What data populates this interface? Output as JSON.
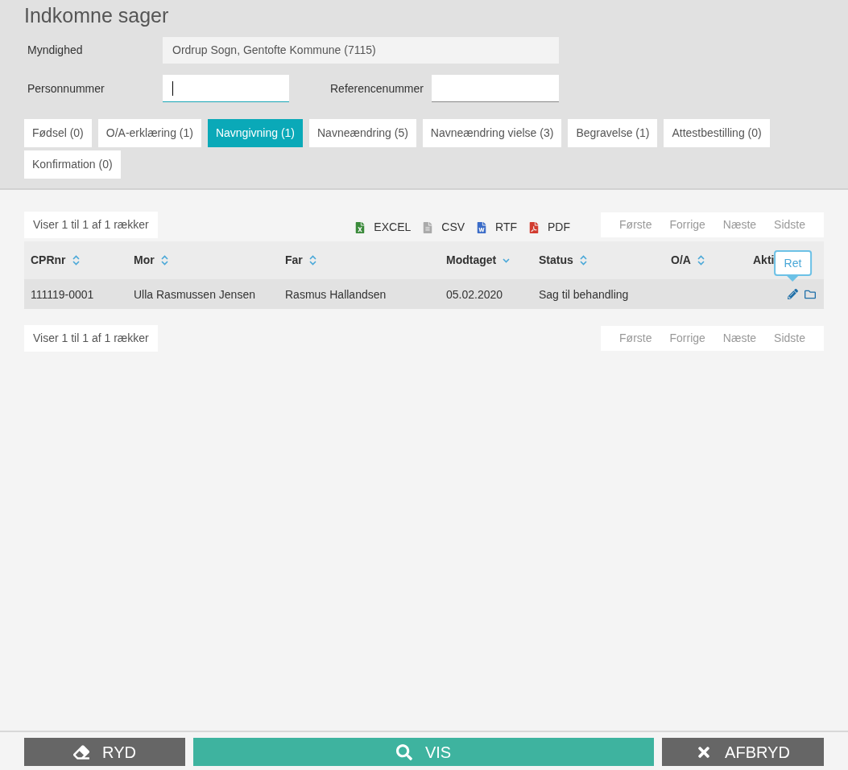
{
  "title": "Indkomne sager",
  "fields": [
    {
      "label": "Myndighed",
      "value": "Ordrup Sogn, Gentofte Kommune (7115)",
      "kind": "readonly"
    }
  ],
  "person_field": {
    "label": "Personnummer",
    "focused": true
  },
  "reference_field": {
    "label": "Referencenummer",
    "focused": false
  },
  "tabs": [
    {
      "label": "Fødsel (0)",
      "selected": false
    },
    {
      "label": "O/A-erklæring (1)",
      "selected": false
    },
    {
      "label": "Navngivning (1)",
      "selected": true
    },
    {
      "label": "Navneændring (5)",
      "selected": false
    },
    {
      "label": "Navneændring vielse (3)",
      "selected": false
    },
    {
      "label": "Begravelse (1)",
      "selected": false
    },
    {
      "label": "Attestbestilling (0)",
      "selected": false
    },
    {
      "label": "Konfirmation (0)",
      "selected": false
    }
  ],
  "info_top": "Viser 1 til 1 af 1 rækker",
  "exports": [
    {
      "label": "EXCEL",
      "kind": "excel"
    },
    {
      "label": "CSV",
      "kind": "csv"
    },
    {
      "label": "RTF",
      "kind": "rtf"
    },
    {
      "label": "PDF",
      "kind": "pdf"
    }
  ],
  "pager_top": [
    "Første",
    "Forrige",
    "Næste",
    "Sidste"
  ],
  "table": {
    "columns": [
      {
        "label": "CPRnr",
        "sorted": false
      },
      {
        "label": "Mor",
        "sorted": false
      },
      {
        "label": "Far",
        "sorted": false
      },
      {
        "label": "Modtaget",
        "sorted": true
      },
      {
        "label": "Status",
        "sorted": false
      },
      {
        "label": "O/A",
        "sorted": false
      },
      {
        "label": "Akti",
        "sorted": false
      }
    ],
    "rows": [
      {
        "cells": [
          "111119-0001",
          "Ulla Rasmussen Jensen",
          "Rasmus Hallandsen",
          "05.02.2020",
          "Sag til behandling",
          ""
        ]
      }
    ]
  },
  "tooltip": "Ret",
  "info_bottom": "Viser 1 til 1 af 1 rækker",
  "pager_bottom": [
    "Første",
    "Forrige",
    "Næste",
    "Sidste"
  ],
  "buttons": [
    {
      "label": "RYD",
      "kind": "clear"
    },
    {
      "label": "VIS",
      "kind": "show"
    },
    {
      "label": "AFBRYD",
      "kind": "cancel"
    }
  ]
}
